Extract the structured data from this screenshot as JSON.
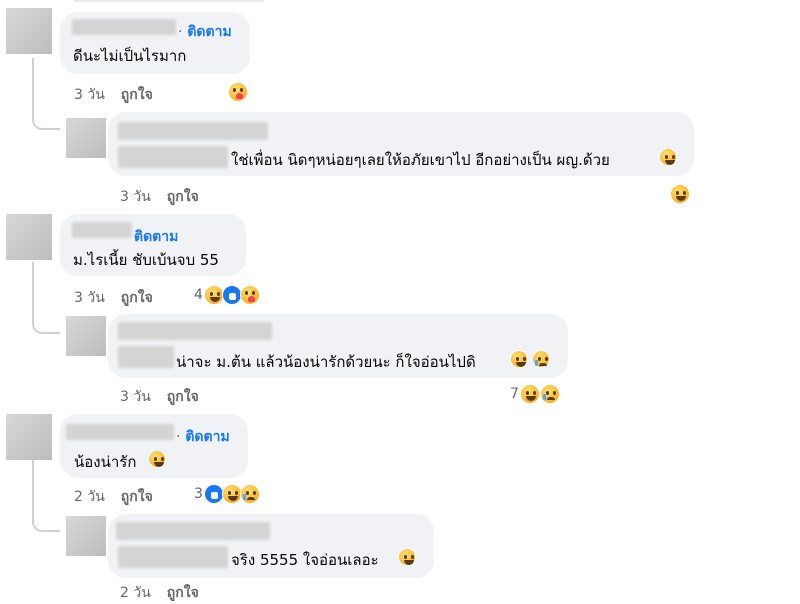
{
  "follow_label": "ติดตาม",
  "follow_sep": "·",
  "like_label": "ถูกใจ",
  "comments": [
    {
      "text": "ดีนะไม่เป็นไรมาก",
      "time": "3 วัน",
      "reaction_count": ""
    },
    {
      "text": "ใช่เพื่อน นิดๆหน่อยๆเลยให้อภัยเขาไป อีกอย่างเป็น ผญ.ด้วย",
      "time": "3 วัน",
      "reaction_count": ""
    },
    {
      "text": "ม.ไรเนี้ย ชับเบ้นจบ 55",
      "time": "3 วัน",
      "reaction_count": "4"
    },
    {
      "text": "น่าจะ ม.ต้น แล้วน้องน่ารักด้วยนะ ก็ใจอ่อนไปดิ",
      "time": "3 วัน",
      "reaction_count": "7"
    },
    {
      "text": "น้องน่ารัก",
      "time": "2 วัน",
      "reaction_count": "3"
    },
    {
      "text": "จริง 5555 ใจอ่อนเลอะ",
      "time": "2 วัน",
      "reaction_count": ""
    }
  ],
  "icons": {
    "care": "care-reaction-icon",
    "haha": "haha-reaction-icon",
    "like": "like-reaction-icon",
    "sad": "sad-reaction-icon",
    "cry": "cry-laugh-icon"
  }
}
